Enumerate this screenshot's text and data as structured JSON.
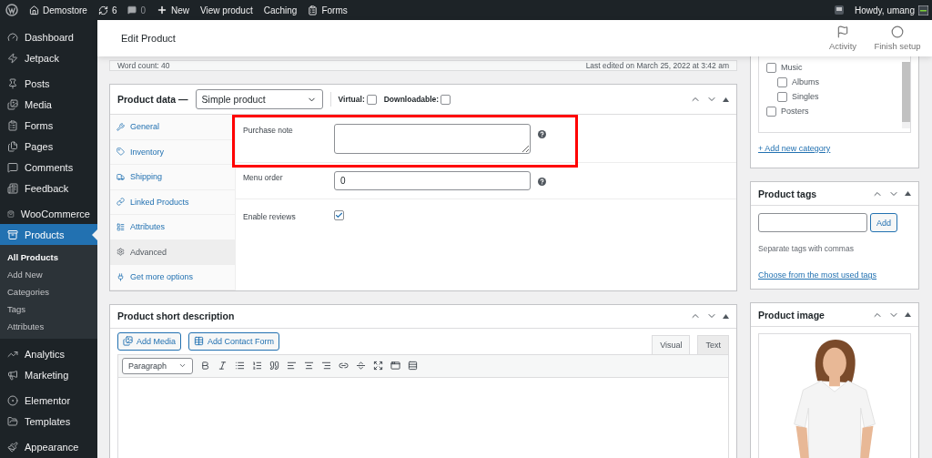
{
  "admin_bar": {
    "items": [
      {
        "kind": "logo"
      },
      {
        "kind": "home",
        "label": "Demostore"
      },
      {
        "kind": "updates",
        "label": "6"
      },
      {
        "kind": "comments",
        "label": "0"
      },
      {
        "kind": "new",
        "label": "New"
      },
      {
        "kind": "link",
        "label": "View product"
      },
      {
        "kind": "link",
        "label": "Caching"
      },
      {
        "kind": "forms",
        "label": "Forms"
      }
    ],
    "greeting": "Howdy, umang"
  },
  "sidebar": {
    "groups": [
      {
        "items": [
          {
            "label": "Dashboard",
            "selected": false
          },
          {
            "label": "Jetpack",
            "selected": false
          }
        ]
      },
      {
        "items": [
          {
            "label": "Posts",
            "selected": false
          },
          {
            "label": "Media",
            "selected": false
          },
          {
            "label": "Forms",
            "selected": false
          },
          {
            "label": "Pages",
            "selected": false
          },
          {
            "label": "Comments",
            "selected": false
          },
          {
            "label": "Feedback",
            "selected": false
          }
        ]
      },
      {
        "items": [
          {
            "label": "WooCommerce",
            "selected": false
          },
          {
            "label": "Products",
            "selected": true,
            "children": [
              {
                "label": "All Products",
                "selected": true
              },
              {
                "label": "Add New",
                "selected": false
              },
              {
                "label": "Categories",
                "selected": false
              },
              {
                "label": "Tags",
                "selected": false
              },
              {
                "label": "Attributes",
                "selected": false
              }
            ]
          }
        ]
      },
      {
        "items": [
          {
            "label": "Analytics",
            "selected": false
          },
          {
            "label": "Marketing",
            "selected": false
          }
        ]
      },
      {
        "items": [
          {
            "label": "Elementor",
            "selected": false
          },
          {
            "label": "Templates",
            "selected": false
          }
        ]
      },
      {
        "items": [
          {
            "label": "Appearance",
            "selected": false
          }
        ]
      }
    ]
  },
  "header": {
    "title": "Edit Product",
    "actions": [
      "Activity",
      "Finish setup"
    ]
  },
  "editor_status": {
    "word_count": "Word count: 40",
    "last_edited": "Last edited on March 25, 2022 at 3:42 am"
  },
  "product_data": {
    "title": "Product data —",
    "type": "Simple product",
    "options": [
      {
        "label": "Virtual:",
        "checked": false
      },
      {
        "label": "Downloadable:",
        "checked": false
      }
    ],
    "tabs": [
      {
        "label": "General",
        "selected": false
      },
      {
        "label": "Inventory",
        "selected": false
      },
      {
        "label": "Shipping",
        "selected": false
      },
      {
        "label": "Linked Products",
        "selected": false
      },
      {
        "label": "Attributes",
        "selected": false
      },
      {
        "label": "Advanced",
        "selected": true
      },
      {
        "label": "Get more options",
        "selected": false
      }
    ],
    "fields": [
      {
        "kind": "textarea",
        "label": "Purchase note",
        "highlighted": true
      },
      {
        "kind": "input",
        "label": "Menu order",
        "value": "0",
        "highlighted": false
      },
      {
        "kind": "checkbox",
        "label": "Enable reviews",
        "checked": true,
        "highlighted": false
      }
    ]
  },
  "short_description": {
    "title": "Product short description",
    "media_buttons": [
      "Add Media",
      "Add Contact Form"
    ],
    "editor_tabs": [
      {
        "label": "Visual",
        "selected": true
      },
      {
        "label": "Text",
        "selected": false
      }
    ],
    "format": "Paragraph"
  },
  "categories": {
    "items": [
      {
        "label": "Music",
        "checked": false,
        "children": [
          {
            "label": "Albums",
            "checked": false
          },
          {
            "label": "Singles",
            "checked": false
          }
        ]
      },
      {
        "label": "Posters",
        "checked": false
      }
    ],
    "add_link": "+ Add new category"
  },
  "tags": {
    "title": "Product tags",
    "button": "Add",
    "hint": "Separate tags with commas",
    "link": "Choose from the most used tags"
  },
  "image": {
    "title": "Product image",
    "kind": "picture"
  }
}
